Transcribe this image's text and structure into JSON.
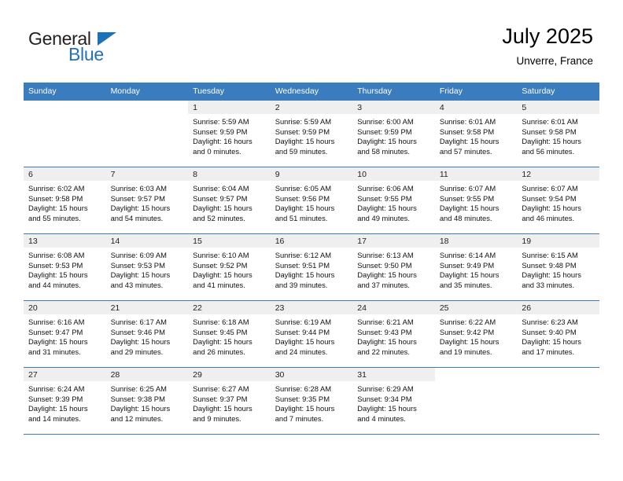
{
  "brand": {
    "name_top": "General",
    "name_bottom": "Blue",
    "triangle_color": "#1c72b8",
    "blue_color": "#2172b8"
  },
  "header": {
    "title": "July 2025",
    "location": "Unverre, France"
  },
  "calendar": {
    "header_bg": "#3a7cbe",
    "daynum_band_bg": "#efefef",
    "weekdays": [
      "Sunday",
      "Monday",
      "Tuesday",
      "Wednesday",
      "Thursday",
      "Friday",
      "Saturday"
    ],
    "weeks": [
      [
        {
          "day": "",
          "sunrise": "",
          "sunset": "",
          "daylight_line1": "",
          "daylight_line2": ""
        },
        {
          "day": "",
          "sunrise": "",
          "sunset": "",
          "daylight_line1": "",
          "daylight_line2": ""
        },
        {
          "day": "1",
          "sunrise": "Sunrise: 5:59 AM",
          "sunset": "Sunset: 9:59 PM",
          "daylight_line1": "Daylight: 16 hours",
          "daylight_line2": "and 0 minutes."
        },
        {
          "day": "2",
          "sunrise": "Sunrise: 5:59 AM",
          "sunset": "Sunset: 9:59 PM",
          "daylight_line1": "Daylight: 15 hours",
          "daylight_line2": "and 59 minutes."
        },
        {
          "day": "3",
          "sunrise": "Sunrise: 6:00 AM",
          "sunset": "Sunset: 9:59 PM",
          "daylight_line1": "Daylight: 15 hours",
          "daylight_line2": "and 58 minutes."
        },
        {
          "day": "4",
          "sunrise": "Sunrise: 6:01 AM",
          "sunset": "Sunset: 9:58 PM",
          "daylight_line1": "Daylight: 15 hours",
          "daylight_line2": "and 57 minutes."
        },
        {
          "day": "5",
          "sunrise": "Sunrise: 6:01 AM",
          "sunset": "Sunset: 9:58 PM",
          "daylight_line1": "Daylight: 15 hours",
          "daylight_line2": "and 56 minutes."
        }
      ],
      [
        {
          "day": "6",
          "sunrise": "Sunrise: 6:02 AM",
          "sunset": "Sunset: 9:58 PM",
          "daylight_line1": "Daylight: 15 hours",
          "daylight_line2": "and 55 minutes."
        },
        {
          "day": "7",
          "sunrise": "Sunrise: 6:03 AM",
          "sunset": "Sunset: 9:57 PM",
          "daylight_line1": "Daylight: 15 hours",
          "daylight_line2": "and 54 minutes."
        },
        {
          "day": "8",
          "sunrise": "Sunrise: 6:04 AM",
          "sunset": "Sunset: 9:57 PM",
          "daylight_line1": "Daylight: 15 hours",
          "daylight_line2": "and 52 minutes."
        },
        {
          "day": "9",
          "sunrise": "Sunrise: 6:05 AM",
          "sunset": "Sunset: 9:56 PM",
          "daylight_line1": "Daylight: 15 hours",
          "daylight_line2": "and 51 minutes."
        },
        {
          "day": "10",
          "sunrise": "Sunrise: 6:06 AM",
          "sunset": "Sunset: 9:55 PM",
          "daylight_line1": "Daylight: 15 hours",
          "daylight_line2": "and 49 minutes."
        },
        {
          "day": "11",
          "sunrise": "Sunrise: 6:07 AM",
          "sunset": "Sunset: 9:55 PM",
          "daylight_line1": "Daylight: 15 hours",
          "daylight_line2": "and 48 minutes."
        },
        {
          "day": "12",
          "sunrise": "Sunrise: 6:07 AM",
          "sunset": "Sunset: 9:54 PM",
          "daylight_line1": "Daylight: 15 hours",
          "daylight_line2": "and 46 minutes."
        }
      ],
      [
        {
          "day": "13",
          "sunrise": "Sunrise: 6:08 AM",
          "sunset": "Sunset: 9:53 PM",
          "daylight_line1": "Daylight: 15 hours",
          "daylight_line2": "and 44 minutes."
        },
        {
          "day": "14",
          "sunrise": "Sunrise: 6:09 AM",
          "sunset": "Sunset: 9:53 PM",
          "daylight_line1": "Daylight: 15 hours",
          "daylight_line2": "and 43 minutes."
        },
        {
          "day": "15",
          "sunrise": "Sunrise: 6:10 AM",
          "sunset": "Sunset: 9:52 PM",
          "daylight_line1": "Daylight: 15 hours",
          "daylight_line2": "and 41 minutes."
        },
        {
          "day": "16",
          "sunrise": "Sunrise: 6:12 AM",
          "sunset": "Sunset: 9:51 PM",
          "daylight_line1": "Daylight: 15 hours",
          "daylight_line2": "and 39 minutes."
        },
        {
          "day": "17",
          "sunrise": "Sunrise: 6:13 AM",
          "sunset": "Sunset: 9:50 PM",
          "daylight_line1": "Daylight: 15 hours",
          "daylight_line2": "and 37 minutes."
        },
        {
          "day": "18",
          "sunrise": "Sunrise: 6:14 AM",
          "sunset": "Sunset: 9:49 PM",
          "daylight_line1": "Daylight: 15 hours",
          "daylight_line2": "and 35 minutes."
        },
        {
          "day": "19",
          "sunrise": "Sunrise: 6:15 AM",
          "sunset": "Sunset: 9:48 PM",
          "daylight_line1": "Daylight: 15 hours",
          "daylight_line2": "and 33 minutes."
        }
      ],
      [
        {
          "day": "20",
          "sunrise": "Sunrise: 6:16 AM",
          "sunset": "Sunset: 9:47 PM",
          "daylight_line1": "Daylight: 15 hours",
          "daylight_line2": "and 31 minutes."
        },
        {
          "day": "21",
          "sunrise": "Sunrise: 6:17 AM",
          "sunset": "Sunset: 9:46 PM",
          "daylight_line1": "Daylight: 15 hours",
          "daylight_line2": "and 29 minutes."
        },
        {
          "day": "22",
          "sunrise": "Sunrise: 6:18 AM",
          "sunset": "Sunset: 9:45 PM",
          "daylight_line1": "Daylight: 15 hours",
          "daylight_line2": "and 26 minutes."
        },
        {
          "day": "23",
          "sunrise": "Sunrise: 6:19 AM",
          "sunset": "Sunset: 9:44 PM",
          "daylight_line1": "Daylight: 15 hours",
          "daylight_line2": "and 24 minutes."
        },
        {
          "day": "24",
          "sunrise": "Sunrise: 6:21 AM",
          "sunset": "Sunset: 9:43 PM",
          "daylight_line1": "Daylight: 15 hours",
          "daylight_line2": "and 22 minutes."
        },
        {
          "day": "25",
          "sunrise": "Sunrise: 6:22 AM",
          "sunset": "Sunset: 9:42 PM",
          "daylight_line1": "Daylight: 15 hours",
          "daylight_line2": "and 19 minutes."
        },
        {
          "day": "26",
          "sunrise": "Sunrise: 6:23 AM",
          "sunset": "Sunset: 9:40 PM",
          "daylight_line1": "Daylight: 15 hours",
          "daylight_line2": "and 17 minutes."
        }
      ],
      [
        {
          "day": "27",
          "sunrise": "Sunrise: 6:24 AM",
          "sunset": "Sunset: 9:39 PM",
          "daylight_line1": "Daylight: 15 hours",
          "daylight_line2": "and 14 minutes."
        },
        {
          "day": "28",
          "sunrise": "Sunrise: 6:25 AM",
          "sunset": "Sunset: 9:38 PM",
          "daylight_line1": "Daylight: 15 hours",
          "daylight_line2": "and 12 minutes."
        },
        {
          "day": "29",
          "sunrise": "Sunrise: 6:27 AM",
          "sunset": "Sunset: 9:37 PM",
          "daylight_line1": "Daylight: 15 hours",
          "daylight_line2": "and 9 minutes."
        },
        {
          "day": "30",
          "sunrise": "Sunrise: 6:28 AM",
          "sunset": "Sunset: 9:35 PM",
          "daylight_line1": "Daylight: 15 hours",
          "daylight_line2": "and 7 minutes."
        },
        {
          "day": "31",
          "sunrise": "Sunrise: 6:29 AM",
          "sunset": "Sunset: 9:34 PM",
          "daylight_line1": "Daylight: 15 hours",
          "daylight_line2": "and 4 minutes."
        },
        {
          "day": "",
          "sunrise": "",
          "sunset": "",
          "daylight_line1": "",
          "daylight_line2": ""
        },
        {
          "day": "",
          "sunrise": "",
          "sunset": "",
          "daylight_line1": "",
          "daylight_line2": ""
        }
      ]
    ]
  }
}
